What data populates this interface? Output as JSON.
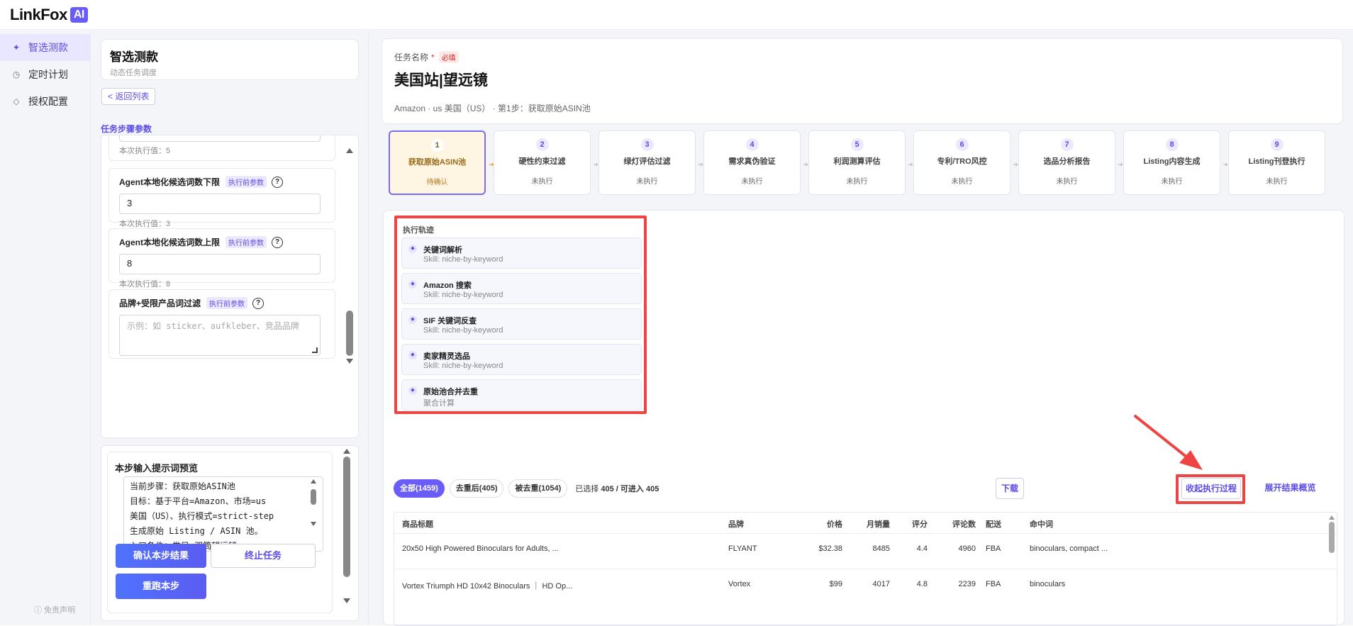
{
  "app": {
    "logo_text": "LinkFox",
    "logo_badge": "AI"
  },
  "nav": {
    "items": [
      {
        "label": "智选测款",
        "icon": "sparkle-icon"
      },
      {
        "label": "定时计划",
        "icon": "clock-icon"
      },
      {
        "label": "授权配置",
        "icon": "diamond-icon"
      }
    ],
    "disclaimer": "ⓘ 免责声明"
  },
  "left": {
    "title": "智选测款",
    "subtitle": "动态任务调度",
    "back_label": "< 返回列表",
    "section_title": "任务步骤参数",
    "params": [
      {
        "value": "5",
        "footer": "本次执行值：5"
      },
      {
        "label": "Agent本地化候选词数下限",
        "tag": "执行前参数",
        "value": "3",
        "footer": "本次执行值：3"
      },
      {
        "label": "Agent本地化候选词数上限",
        "tag": "执行前参数",
        "value": "8",
        "footer": "本次执行值：8"
      },
      {
        "label": "品牌+受限产品词过滤",
        "tag": "执行前参数",
        "placeholder": "示例：如 sticker、aufkleber、竞品品牌"
      }
    ],
    "preview_title": "本步输入提示词预览",
    "preview_text": "当前步骤：获取原始ASIN池\n目标：基于平台=Amazon、市场=us\n美国（US）、执行模式=strict-step\n生成原始 Listing / ASIN 池。\n入口条件：类目=双筒望远镜。",
    "btn_confirm": "确认本步结果",
    "btn_stop": "终止任务",
    "btn_rerun": "重跑本步"
  },
  "task": {
    "label": "任务名称",
    "required_star": "*",
    "required_tag": "必填",
    "title": "美国站|望远镜",
    "meta": "Amazon · us 美国（US） · 第1步：获取原始ASIN池"
  },
  "steps": [
    {
      "num": "1",
      "name": "获取原始ASIN池",
      "status": "待确认"
    },
    {
      "num": "2",
      "name": "硬性约束过滤",
      "status": "未执行"
    },
    {
      "num": "3",
      "name": "绿灯评估过滤",
      "status": "未执行"
    },
    {
      "num": "4",
      "name": "需求真伪验证",
      "status": "未执行"
    },
    {
      "num": "5",
      "name": "利润测算评估",
      "status": "未执行"
    },
    {
      "num": "6",
      "name": "专利/TRO风控",
      "status": "未执行"
    },
    {
      "num": "7",
      "name": "选品分析报告",
      "status": "未执行"
    },
    {
      "num": "8",
      "name": "Listing内容生成",
      "status": "未执行"
    },
    {
      "num": "9",
      "name": "Listing刊登执行",
      "status": "未执行"
    }
  ],
  "trace": {
    "title": "执行轨迹",
    "items": [
      {
        "name": "关键词解析",
        "skill": "Skill: niche-by-keyword"
      },
      {
        "name": "Amazon 搜索",
        "skill": "Skill: niche-by-keyword"
      },
      {
        "name": "SIF 关键词反查",
        "skill": "Skill: niche-by-keyword"
      },
      {
        "name": "卖家精灵选品",
        "skill": "Skill: niche-by-keyword"
      },
      {
        "name": "原始池合并去重",
        "skill": "聚合计算"
      }
    ]
  },
  "filters": {
    "all": "全部(1459)",
    "dedup": "去重后(405)",
    "removed": "被去重(1054)",
    "sel_prefix": "已选择",
    "sel_count": "405",
    "sel_mid": "/ 可进入",
    "sel_total": "405"
  },
  "actions": {
    "download": "下载",
    "collapse": "收起执行过程",
    "expand": "展开结果概览"
  },
  "table": {
    "headers": [
      "商品标题",
      "品牌",
      "价格",
      "月销量",
      "评分",
      "评论数",
      "配送",
      "命中词"
    ],
    "rows": [
      [
        "20x50 High Powered Binoculars for Adults, ...",
        "FLYANT",
        "$32.38",
        "8485",
        "4.4",
        "4960",
        "FBA",
        "binoculars, compact ..."
      ],
      [
        "Vortex Triumph HD 10x42 Binoculars ｜ HD Op...",
        "Vortex",
        "$99",
        "4017",
        "4.8",
        "2239",
        "FBA",
        "binoculars"
      ]
    ]
  },
  "colors": {
    "accent": "#6a5cf6",
    "highlight": "#ee4444",
    "active_step_bg": "#fff5e3"
  }
}
